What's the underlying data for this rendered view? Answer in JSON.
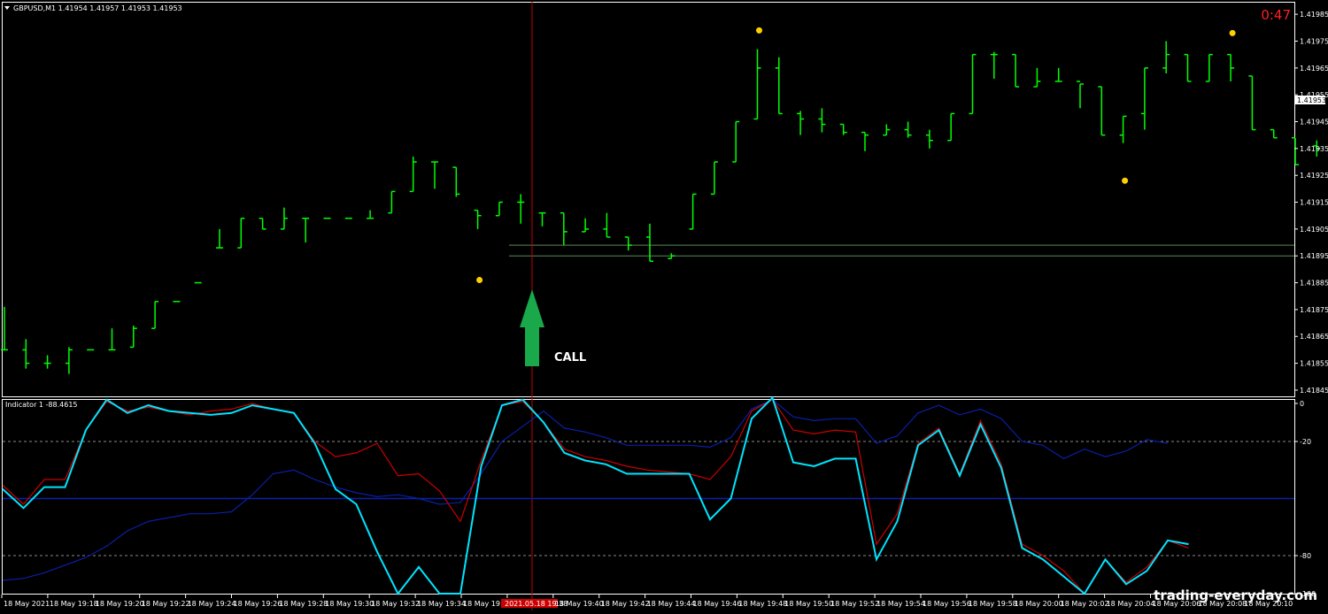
{
  "window": {
    "symbol_header": "GBPUSD,M1  1.41954 1.41957 1.41953 1.41953",
    "countdown": "0:47",
    "current_price_label": "1.41953"
  },
  "signal": {
    "label": "CALL",
    "type": "call"
  },
  "watermark": "trading-everyday.com",
  "indicator": {
    "header": "Indicator 1 -88.4615"
  },
  "x_axis": {
    "labels": [
      "18 May 2021",
      "18 May 19:18",
      "18 May 19:20",
      "18 May 19:22",
      "18 May 19:24",
      "18 May 19:26",
      "18 May 19:28",
      "18 May 19:30",
      "18 May 19:32",
      "18 May 19:34",
      "18 May 19:36",
      "2021.05.18 19:38",
      "18 May 19:40",
      "18 May 19:42",
      "18 May 19:44",
      "18 May 19:46",
      "18 May 19:48",
      "18 May 19:50",
      "18 May 19:52",
      "18 May 19:54",
      "18 May 19:56",
      "18 May 19:58",
      "18 May 20:00",
      "18 May 20:02",
      "18 May 20:04",
      "18 May 20:06",
      "18 May 20:08",
      "18 May 20:10"
    ],
    "highlighted_index": 11
  },
  "colors": {
    "bars": "#00ff00",
    "dots": "#ffd000",
    "cursor_line": "#c00000",
    "cyan_line": "#00e5ff",
    "red_line": "#cc0000",
    "navy_line": "#0a1fa8",
    "level_line": "#0a1fa8",
    "sr_lines": "#5a8a5a",
    "arrow": "#19a84a",
    "countdown": "#ff2020",
    "highlight_label_bg": "#cc0000"
  },
  "chart_data": [
    {
      "type": "ohlc",
      "series_name": "GBPUSD,M1",
      "y_ticks": [
        "1.41985",
        "1.41975",
        "1.41965",
        "1.41955",
        "1.41945",
        "1.41935",
        "1.41925",
        "1.41915",
        "1.41905",
        "1.41895",
        "1.41885",
        "1.41875",
        "1.41865",
        "1.41855",
        "1.41845"
      ],
      "ylim": [
        1.41843,
        1.41989
      ],
      "bars": [
        [
          1.4186,
          1.41876,
          1.4186,
          1.4186
        ],
        [
          1.4186,
          1.41864,
          1.41853,
          1.41855
        ],
        [
          1.41855,
          1.41858,
          1.41853,
          1.41855
        ],
        [
          1.41855,
          1.41861,
          1.41851,
          1.4186
        ],
        [
          1.4186,
          1.4186,
          1.4186,
          1.4186
        ],
        [
          1.4186,
          1.41868,
          1.4186,
          1.4186
        ],
        [
          1.41861,
          1.41869,
          1.41861,
          1.41868
        ],
        [
          1.41868,
          1.41878,
          1.41868,
          1.41878
        ],
        [
          1.41878,
          1.41878,
          1.41878,
          1.41878
        ],
        [
          1.41885,
          1.41885,
          1.41885,
          1.41885
        ],
        [
          1.41898,
          1.41905,
          1.41898,
          1.41898
        ],
        [
          1.41898,
          1.41909,
          1.41898,
          1.41909
        ],
        [
          1.41909,
          1.41909,
          1.41905,
          1.41905
        ],
        [
          1.41905,
          1.41913,
          1.41905,
          1.41909
        ],
        [
          1.41909,
          1.41909,
          1.419,
          1.41909
        ],
        [
          1.41909,
          1.41909,
          1.41909,
          1.41909
        ],
        [
          1.41909,
          1.41909,
          1.41909,
          1.41909
        ],
        [
          1.41909,
          1.41912,
          1.41909,
          1.41909
        ],
        [
          1.41911,
          1.41919,
          1.41911,
          1.41919
        ],
        [
          1.41919,
          1.41932,
          1.41919,
          1.4193
        ],
        [
          1.4193,
          1.4193,
          1.4192,
          1.4193
        ],
        [
          1.41928,
          1.41928,
          1.41917,
          1.41918
        ],
        [
          1.41912,
          1.41912,
          1.41905,
          1.4191
        ],
        [
          1.4191,
          1.41915,
          1.4191,
          1.41915
        ],
        [
          1.41915,
          1.41918,
          1.41907,
          1.41915
        ],
        [
          1.41911,
          1.41911,
          1.41906,
          1.41911
        ],
        [
          1.41911,
          1.41911,
          1.41899,
          1.41904
        ],
        [
          1.41904,
          1.41909,
          1.41904,
          1.41905
        ],
        [
          1.41905,
          1.41911,
          1.41902,
          1.41902
        ],
        [
          1.41902,
          1.41902,
          1.41897,
          1.41899
        ],
        [
          1.41902,
          1.41907,
          1.41893,
          1.41893
        ],
        [
          1.41894,
          1.41896,
          1.41894,
          1.41895
        ],
        [
          1.41905,
          1.41918,
          1.41905,
          1.41918
        ],
        [
          1.41918,
          1.4193,
          1.41918,
          1.4193
        ],
        [
          1.4193,
          1.41945,
          1.4193,
          1.41945
        ],
        [
          1.41946,
          1.41972,
          1.41946,
          1.41965
        ],
        [
          1.41965,
          1.41969,
          1.41948,
          1.41948
        ],
        [
          1.41948,
          1.41949,
          1.4194,
          1.41946
        ],
        [
          1.41946,
          1.4195,
          1.41941,
          1.41944
        ],
        [
          1.41944,
          1.41944,
          1.4194,
          1.41941
        ],
        [
          1.41941,
          1.41941,
          1.41934,
          1.4194
        ],
        [
          1.4194,
          1.41944,
          1.4194,
          1.41942
        ],
        [
          1.41942,
          1.41945,
          1.41939,
          1.4194
        ],
        [
          1.4194,
          1.41942,
          1.41935,
          1.41938
        ],
        [
          1.41938,
          1.41948,
          1.41938,
          1.41948
        ],
        [
          1.41948,
          1.4197,
          1.41948,
          1.4197
        ],
        [
          1.4197,
          1.41971,
          1.41961,
          1.4197
        ],
        [
          1.4197,
          1.4197,
          1.41958,
          1.41958
        ],
        [
          1.41958,
          1.41965,
          1.41958,
          1.4196
        ],
        [
          1.4196,
          1.41965,
          1.4196,
          1.4196
        ],
        [
          1.4196,
          1.41959,
          1.4195,
          1.41959
        ],
        [
          1.41958,
          1.41958,
          1.4194,
          1.4194
        ],
        [
          1.4194,
          1.41947,
          1.41937,
          1.41947
        ],
        [
          1.41948,
          1.41965,
          1.41942,
          1.41965
        ],
        [
          1.41965,
          1.41975,
          1.41963,
          1.4197
        ],
        [
          1.4197,
          1.4197,
          1.4196,
          1.4196
        ],
        [
          1.4196,
          1.4197,
          1.4196,
          1.4197
        ],
        [
          1.4197,
          1.4197,
          1.4196,
          1.41965
        ],
        [
          1.41962,
          1.41962,
          1.41942,
          1.41942
        ],
        [
          1.41942,
          1.41942,
          1.41939,
          1.41939
        ],
        [
          1.41939,
          1.41939,
          1.41929,
          1.41929
        ],
        [
          1.41936,
          1.41938,
          1.41932,
          1.41935
        ],
        [
          1.41935,
          1.41937,
          1.41929,
          1.41929
        ],
        [
          1.41929,
          1.41935,
          1.41929,
          1.41935
        ],
        [
          1.41935,
          1.41945,
          1.41935,
          1.4194
        ]
      ],
      "high_low_markers": [
        {
          "bar": 35,
          "price": 1.41979
        },
        {
          "bar": 22,
          "price": 1.41886
        },
        {
          "bar": 57,
          "price": 1.41978
        },
        {
          "bar": 52,
          "price": 1.41923
        }
      ],
      "horizontal_levels": [
        1.41899,
        1.41895
      ]
    },
    {
      "type": "line",
      "title": "Indicator 1 -88.4615",
      "y_ticks": [
        "0",
        "-20",
        "-80",
        "-100"
      ],
      "ylim": [
        -100,
        0
      ],
      "dashed_levels": [
        -20,
        -80
      ],
      "solid_level": -50,
      "series": [
        {
          "color": "cyan",
          "values": [
            -45,
            -55,
            -44,
            -44,
            -14,
            2,
            -5,
            -1,
            -4,
            -5,
            -6,
            -5,
            -1,
            -3,
            -5,
            -21,
            -45,
            -53,
            -78,
            -100,
            -86,
            -100,
            -100,
            -33,
            -1,
            2,
            -10,
            -26,
            -30,
            -32,
            -37,
            -37,
            -37,
            -37,
            -61,
            -50,
            -8,
            3,
            -31,
            -33,
            -29,
            -29,
            -82,
            -62,
            -22,
            -14,
            -38,
            -11,
            -34,
            -76,
            -82,
            -91,
            -100,
            -82,
            -95,
            -88,
            -72,
            -74
          ]
        },
        {
          "color": "red",
          "values": [
            -43,
            -53,
            -40,
            -40,
            -14,
            1,
            -4,
            -2,
            -4,
            -6,
            -4,
            -3,
            0,
            -3,
            -5,
            -20,
            -28,
            -26,
            -21,
            -38,
            -37,
            -46,
            -62,
            -30,
            -1,
            1,
            -10,
            -24,
            -28,
            -30,
            -33,
            -35,
            -36,
            -37,
            -40,
            -28,
            -4,
            2,
            -14,
            -16,
            -14,
            -15,
            -74,
            -58,
            -21,
            -13,
            -37,
            -9,
            -32,
            -74,
            -80,
            -88,
            -100,
            -82,
            -94,
            -86,
            -72,
            -76
          ]
        },
        {
          "color": "navy",
          "values": [
            -93,
            -92,
            -89,
            -85,
            -81,
            -75,
            -67,
            -62,
            -60,
            -58,
            -58,
            -57,
            -48,
            -37,
            -35,
            -40,
            -44,
            -47,
            -49,
            -48,
            -50,
            -53,
            -52,
            -37,
            -20,
            -12,
            -4,
            -13,
            -15,
            -18,
            -22,
            -22,
            -22,
            -22,
            -23,
            -18,
            -3,
            2,
            -7,
            -9,
            -8,
            -8,
            -21,
            -17,
            -5,
            -1,
            -6,
            -3,
            -8,
            -20,
            -22,
            -29,
            -24,
            -28,
            -25,
            -19,
            -21
          ]
        }
      ]
    }
  ]
}
